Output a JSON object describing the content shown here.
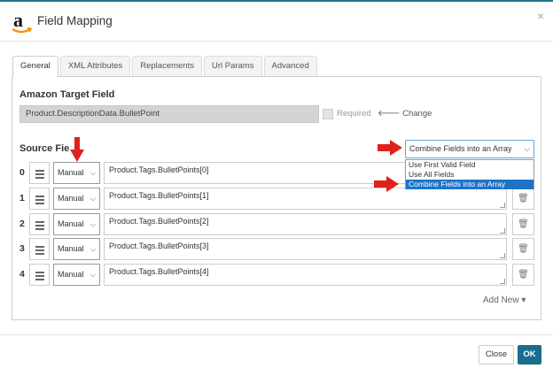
{
  "dialog": {
    "title": "Field Mapping",
    "close_icon": "×",
    "logo_icon": "amazon-logo-icon"
  },
  "tabs": [
    {
      "label": "General",
      "active": true
    },
    {
      "label": "XML Attributes"
    },
    {
      "label": "Replacements"
    },
    {
      "label": "Url Params"
    },
    {
      "label": "Advanced"
    }
  ],
  "target": {
    "heading": "Amazon Target Field",
    "value": "Product.DescriptionData.BulletPoint",
    "required_label": "Required",
    "change_label": "Change"
  },
  "source": {
    "heading": "Source Fie",
    "mode_selected": "Combine Fields into an Array",
    "mode_options": [
      "Use First Valid Field",
      "Use All Fields",
      "Combine Fields into an Array"
    ],
    "rows": [
      {
        "index": "0",
        "type": "Manual",
        "value": "Product.Tags.BulletPoints[0]"
      },
      {
        "index": "1",
        "type": "Manual",
        "value": "Product.Tags.BulletPoints[1]"
      },
      {
        "index": "2",
        "type": "Manual",
        "value": "Product.Tags.BulletPoints[2]"
      },
      {
        "index": "3",
        "type": "Manual",
        "value": "Product.Tags.BulletPoints[3]"
      },
      {
        "index": "4",
        "type": "Manual",
        "value": "Product.Tags.BulletPoints[4]"
      }
    ],
    "add_new_label": "Add New"
  },
  "footer": {
    "close_label": "Close",
    "ok_label": "OK"
  },
  "colors": {
    "accent": "#1a6d8f",
    "annotation_arrow": "#e0201d",
    "dropdown_selected": "#1e73c7"
  }
}
